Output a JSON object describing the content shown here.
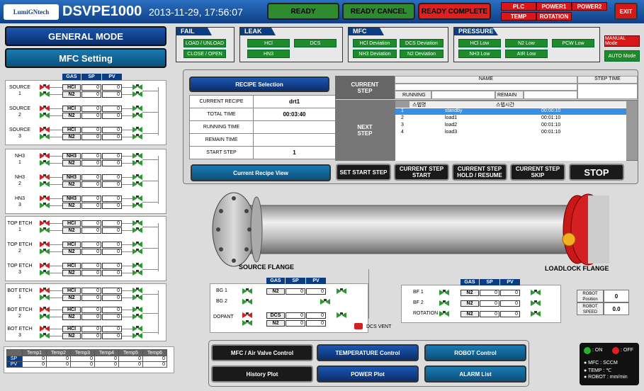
{
  "header": {
    "logo": "LumiGNtech",
    "title": "DSVPE1000",
    "datetime": "2013-11-29, 17:56:07",
    "ready": "READY",
    "ready_cancel": "READY CANCEL",
    "ready_complete": "READY COMPLETE",
    "alarms": [
      "PLC",
      "POWER1",
      "POWER2",
      "TEMP",
      "ROTATION"
    ],
    "exit": "EXIT"
  },
  "modes": {
    "general": "GENERAL MODE",
    "mfc_setting": "MFC Setting"
  },
  "status": {
    "fail": {
      "title": "FAIL",
      "items": [
        "LOAD / UNLOAD",
        "CLOSE / OPEN"
      ]
    },
    "leak": {
      "title": "LEAK",
      "items": [
        "HCl",
        "DCS",
        "HN3"
      ]
    },
    "mfc": {
      "title": "MFC",
      "items": [
        "HCl Deviation",
        "DCS Deviation",
        "NH3 Deviation",
        "N2 Deviation"
      ]
    },
    "pressure": {
      "title": "PRESSURE",
      "items": [
        "HCl Low",
        "N2 Low",
        "PCW Low",
        "NH3 Low",
        "AIR Low"
      ]
    },
    "manual": "MANUAL Mode",
    "auto": "AUTO Mode"
  },
  "mfc_header": {
    "gas": "GAS",
    "sp": "SP",
    "pv": "PV"
  },
  "sources": [
    {
      "label": "SOURCE\n1",
      "g1": "HCl",
      "g2": "N2",
      "sp1": "0",
      "pv1": "0",
      "sp2": "0",
      "pv2": "0"
    },
    {
      "label": "SOURCE\n2",
      "g1": "HCl",
      "g2": "N2",
      "sp1": "0",
      "pv1": "0",
      "sp2": "0",
      "pv2": "0"
    },
    {
      "label": "SOURCE\n3",
      "g1": "HCl",
      "g2": "N2",
      "sp1": "0",
      "pv1": "0",
      "sp2": "0",
      "pv2": "0"
    }
  ],
  "nh3": [
    {
      "label": "NH3\n1",
      "g1": "NH3",
      "g2": "N2",
      "sp1": "0",
      "pv1": "0",
      "sp2": "0",
      "pv2": "0"
    },
    {
      "label": "NH3\n2",
      "g1": "NH3",
      "g2": "N2",
      "sp1": "0",
      "pv1": "0",
      "sp2": "0",
      "pv2": "0"
    },
    {
      "label": "HN3\n3",
      "g1": "NH3",
      "g2": "N2",
      "sp1": "0",
      "pv1": "0",
      "sp2": "0",
      "pv2": "0"
    }
  ],
  "top_etch": [
    {
      "label": "TOP ETCH\n1",
      "g1": "HCl",
      "g2": "N2",
      "sp1": "0",
      "pv1": "0",
      "sp2": "0",
      "pv2": "0"
    },
    {
      "label": "TOP ETCH\n2",
      "g1": "HCl",
      "g2": "N2",
      "sp1": "0",
      "pv1": "0",
      "sp2": "0",
      "pv2": "0"
    },
    {
      "label": "TOP ETCH\n3",
      "g1": "HCl",
      "g2": "N2",
      "sp1": "0",
      "pv1": "0",
      "sp2": "0",
      "pv2": "0"
    }
  ],
  "bot_etch": [
    {
      "label": "BOT ETCH\n1",
      "g1": "HCl",
      "g2": "N2",
      "sp1": "0",
      "pv1": "0",
      "sp2": "0",
      "pv2": "0"
    },
    {
      "label": "BOT ETCH\n2",
      "g1": "HCl",
      "g2": "N2",
      "sp1": "0",
      "pv1": "0",
      "sp2": "0",
      "pv2": "0"
    },
    {
      "label": "BOT ETCH\n3",
      "g1": "HCl",
      "g2": "N2",
      "sp1": "0",
      "pv1": "0",
      "sp2": "0",
      "pv2": "0"
    }
  ],
  "temps": {
    "headers": [
      "Temp1",
      "Temp2",
      "Temp3",
      "Temp4",
      "Temp5",
      "Temp6"
    ],
    "sp_label": "SP",
    "pv_label": "PV",
    "sp": [
      "0",
      "0",
      "0",
      "0",
      "0",
      "0"
    ],
    "pv": [
      "0",
      "0",
      "0",
      "0",
      "0",
      "0"
    ]
  },
  "recipe": {
    "selection": "RECIPE Selection",
    "rows": [
      {
        "k": "CURRENT RECIPE",
        "v": "drt1"
      },
      {
        "k": "TOTAL TIME",
        "v": "00:03:40"
      },
      {
        "k": "RUNNING TIME",
        "v": ""
      },
      {
        "k": "REMAIN TIME",
        "v": ""
      },
      {
        "k": "START STEP",
        "v": "1"
      }
    ],
    "view": "Current Recipe View",
    "current_step": "CURRENT STEP",
    "name": "NAME",
    "step_time": "STEP TIME",
    "running": "RUNNING",
    "remain": "REMAIN",
    "next_step": "NEXT STEP",
    "col_name": "스텝명",
    "col_time": "스텝시간",
    "steps": [
      {
        "n": "1",
        "name": "standby",
        "time": "00:00:10"
      },
      {
        "n": "2",
        "name": "load1",
        "time": "00:01:10"
      },
      {
        "n": "3",
        "name": "load2",
        "time": "00:01:10"
      },
      {
        "n": "4",
        "name": "load3",
        "time": "00:01:10"
      }
    ],
    "buttons": [
      "SET START STEP",
      "CURRENT STEP START",
      "CURRENT STEP HOLD / RESUME",
      "CURRENT STEP SKIP"
    ],
    "stop": "STOP"
  },
  "flanges": {
    "source": "SOURCE FLANGE",
    "loadlock": "LOADLOCK FLANGE"
  },
  "bg": [
    {
      "label": "BG 1",
      "g": "N2",
      "sp": "0",
      "pv": "0"
    },
    {
      "label": "BG 2",
      "g": "",
      "sp": "",
      "pv": ""
    }
  ],
  "dopant": {
    "label": "DOPANT",
    "g1": "DCS",
    "g2": "N2",
    "sp1": "0",
    "pv1": "0",
    "sp2": "0",
    "pv2": "0"
  },
  "dcs_vent": "DCS VENT",
  "bf": [
    {
      "label": "BF 1",
      "g": "N2",
      "sp": "0",
      "pv": "0"
    },
    {
      "label": "BF 2",
      "g": "N2",
      "sp": "0",
      "pv": "0"
    },
    {
      "label": "ROTATION",
      "g": "N2",
      "sp": "0",
      "pv": "0"
    }
  ],
  "robot": {
    "pos_label": "ROBOT Position",
    "pos": "0",
    "speed_label": "ROBOT SPEED",
    "speed": "0.0"
  },
  "nav": [
    "MFC / Air Valve Control",
    "TEMPERATURE Control",
    "ROBOT Control",
    "History Plot",
    "POWER Plot",
    "ALARM List"
  ],
  "legend": {
    "on": ": ON",
    "off": ": OFF",
    "l1": "● MFC : SCCM",
    "l2": "● TEMP : ℃",
    "l3": "● ROBOT : mm/min"
  }
}
